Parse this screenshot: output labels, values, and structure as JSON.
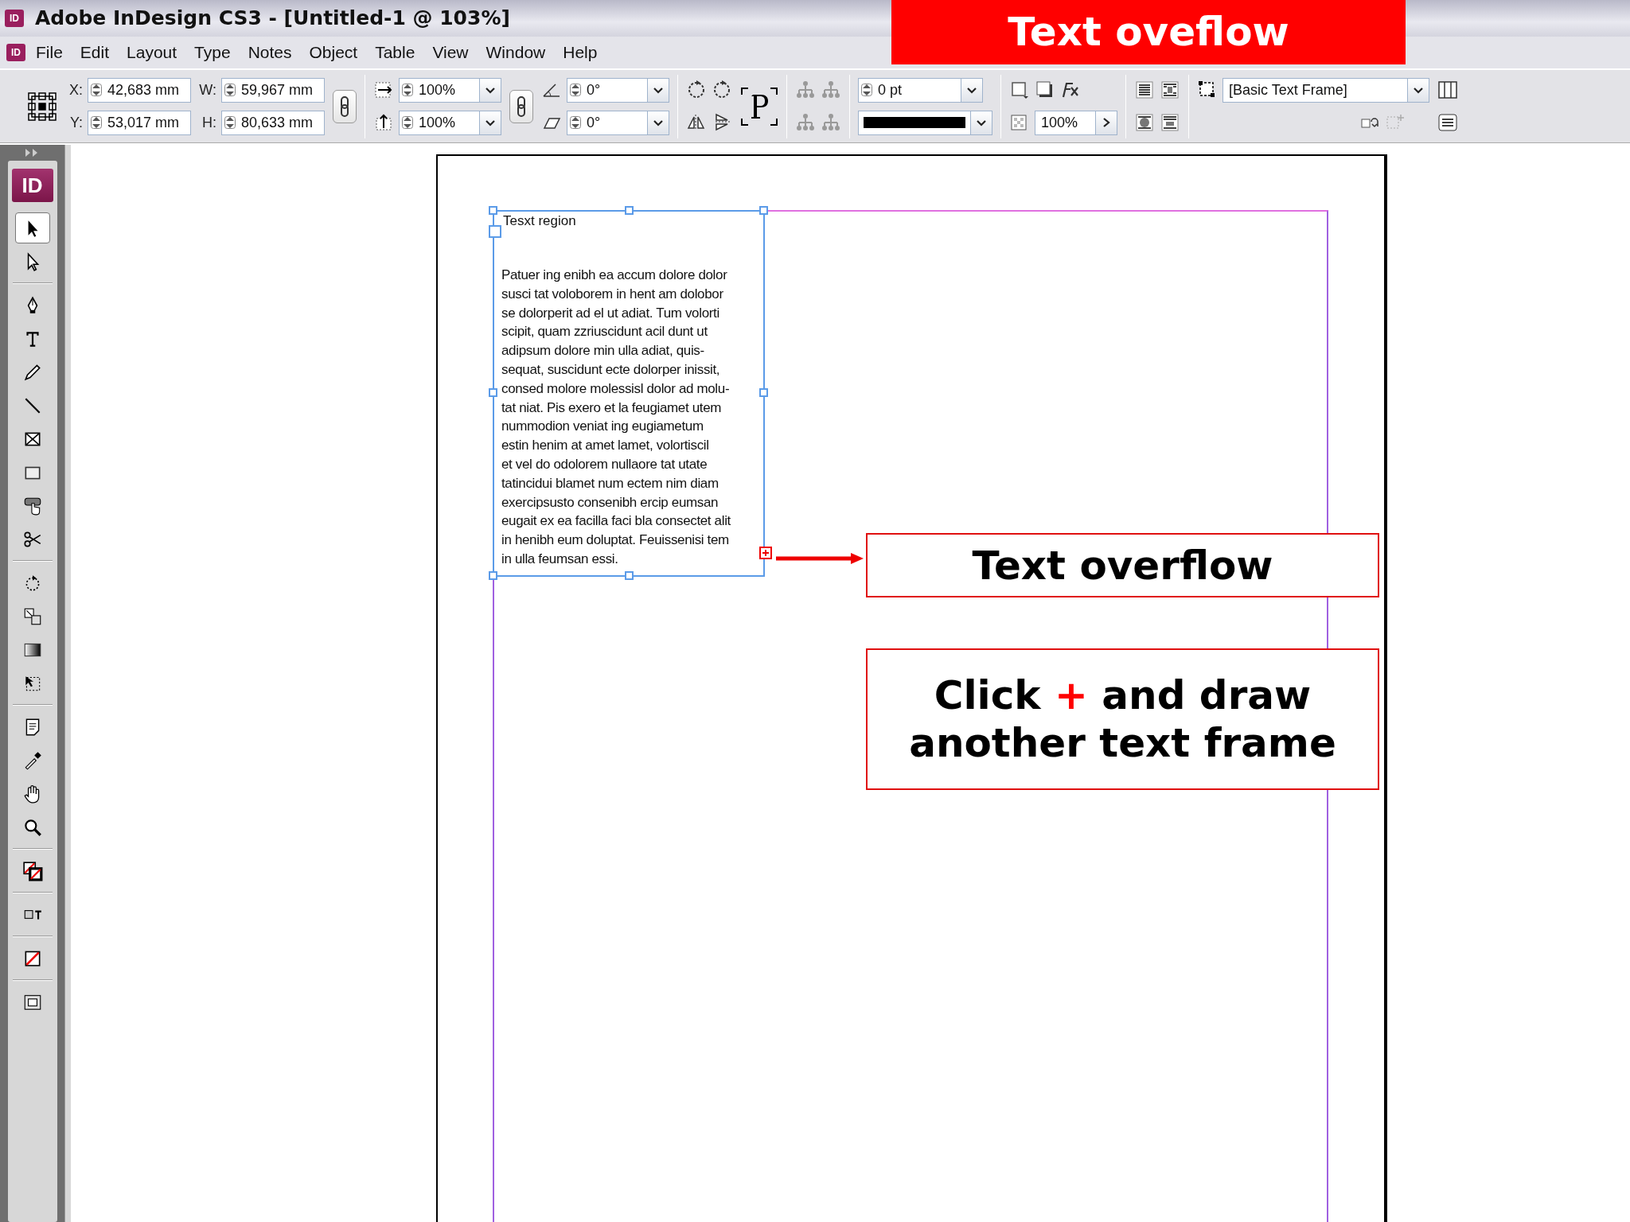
{
  "window": {
    "icon_text": "ID",
    "title": "Adobe InDesign CS3 - [Untitled-1 @ 103%]"
  },
  "banner": {
    "text": "Text oveflow"
  },
  "menu": {
    "icon_text": "ID",
    "items": [
      "File",
      "Edit",
      "Layout",
      "Type",
      "Notes",
      "Object",
      "Table",
      "View",
      "Window",
      "Help"
    ]
  },
  "control_panel": {
    "position": [
      {
        "label": "X:",
        "value": "42,683 mm"
      },
      {
        "label": "Y:",
        "value": "53,017 mm"
      }
    ],
    "size": [
      {
        "label": "W:",
        "value": "59,967 mm"
      },
      {
        "label": "H:",
        "value": "80,633 mm"
      }
    ],
    "scale": [
      {
        "value": "100%"
      },
      {
        "value": "100%"
      }
    ],
    "angles": [
      {
        "value": "0°"
      },
      {
        "value": "0°"
      }
    ],
    "stroke_weight": "0 pt",
    "opacity": "100%",
    "object_style": "[Basic Text Frame]"
  },
  "tools_logo": "ID",
  "tools": [
    {
      "kind": "selection",
      "selected": true
    },
    {
      "kind": "direct",
      "selected": false
    },
    {
      "kind": "pen",
      "selected": false
    },
    {
      "kind": "type",
      "selected": false
    },
    {
      "kind": "pencil",
      "selected": false
    },
    {
      "kind": "line",
      "selected": false
    },
    {
      "kind": "rectframe",
      "selected": false
    },
    {
      "kind": "rect",
      "selected": false
    },
    {
      "kind": "button",
      "selected": false
    },
    {
      "kind": "scissors",
      "selected": false
    },
    {
      "kind": "rotate",
      "selected": false
    },
    {
      "kind": "scale",
      "selected": false
    },
    {
      "kind": "gradient",
      "selected": false
    },
    {
      "kind": "freetransform",
      "selected": false
    },
    {
      "kind": "note",
      "selected": false
    },
    {
      "kind": "eyedropper",
      "selected": false
    },
    {
      "kind": "hand",
      "selected": false
    },
    {
      "kind": "zoom",
      "selected": false
    },
    {
      "kind": "fillstroke",
      "selected": false
    },
    {
      "kind": "formatting",
      "selected": false
    },
    {
      "kind": "applynone",
      "selected": false
    },
    {
      "kind": "screenmode",
      "selected": false
    }
  ],
  "document": {
    "frame": {
      "heading": "Tesxt region",
      "overflow": true,
      "lines": [
        "Patuer ing enibh ea accum dolore dolor",
        "susci tat voloborem in hent am dolobor",
        "se dolorperit ad el ut adiat. Tum volorti",
        "scipit, quam zzriuscidunt acil dunt ut",
        "adipsum dolore min ulla adiat, quis-",
        "sequat, suscidunt ecte dolorper inissit,",
        "consed molore molessisl dolor ad molu-",
        "tat niat. Pis exero et la feugiamet utem",
        "nummodion veniat ing eugiametum",
        "estin henim at amet lamet, volortiscil",
        "et vel do odolorem nullaore tat utate",
        "tatincidui blamet num ectem nim diam",
        "exercipsusto consenibh ercip eumsan",
        "eugait ex ea facilla faci bla consectet alit",
        "in henibh eum doluptat. Feuissenisi tem",
        "in ulla feumsan essi."
      ]
    },
    "callouts": [
      {
        "kind": "label",
        "text": "Text overflow"
      },
      {
        "kind": "instruction",
        "lines": [
          {
            "before": "Click",
            "symbol": "+",
            "after": "and draw"
          },
          {
            "before": "another text frame"
          }
        ]
      }
    ]
  }
}
